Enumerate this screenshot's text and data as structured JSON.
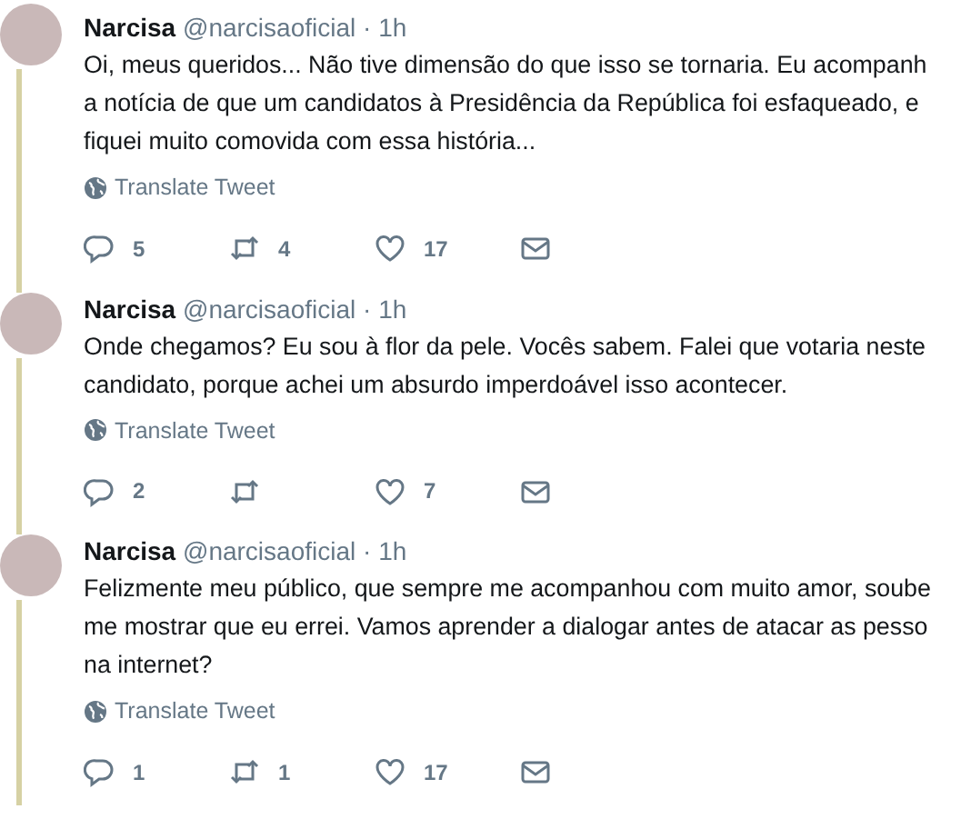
{
  "tweets": [
    {
      "name": "Narcisa",
      "handle": "@narcisaoficial",
      "separator": "·",
      "time": "1h",
      "text_lines": [
        "Oi, meus queridos... Não tive dimensão do que isso se tornaria. Eu acompanh",
        "a notícia de que um candidatos à Presidência da República foi esfaqueado, e",
        "fiquei muito comovida com essa história..."
      ],
      "translate": "Translate Tweet",
      "replies": "5",
      "retweets": "4",
      "likes": "17"
    },
    {
      "name": "Narcisa",
      "handle": "@narcisaoficial",
      "separator": "·",
      "time": "1h",
      "text_lines": [
        "Onde chegamos? Eu sou à flor da pele. Vocês sabem. Falei que votaria neste",
        "candidato, porque achei um absurdo imperdoável isso acontecer."
      ],
      "translate": "Translate Tweet",
      "replies": "2",
      "likes": "7"
    },
    {
      "name": "Narcisa",
      "handle": "@narcisaoficial",
      "separator": "·",
      "time": "1h",
      "text_lines": [
        "Felizmente meu público, que sempre me acompanhou com muito amor, soube",
        "me mostrar que eu errei. Vamos aprender a dialogar antes de atacar as pesso",
        "na internet?"
      ],
      "translate": "Translate Tweet",
      "replies": "1",
      "retweets": "1",
      "likes": "17"
    }
  ]
}
